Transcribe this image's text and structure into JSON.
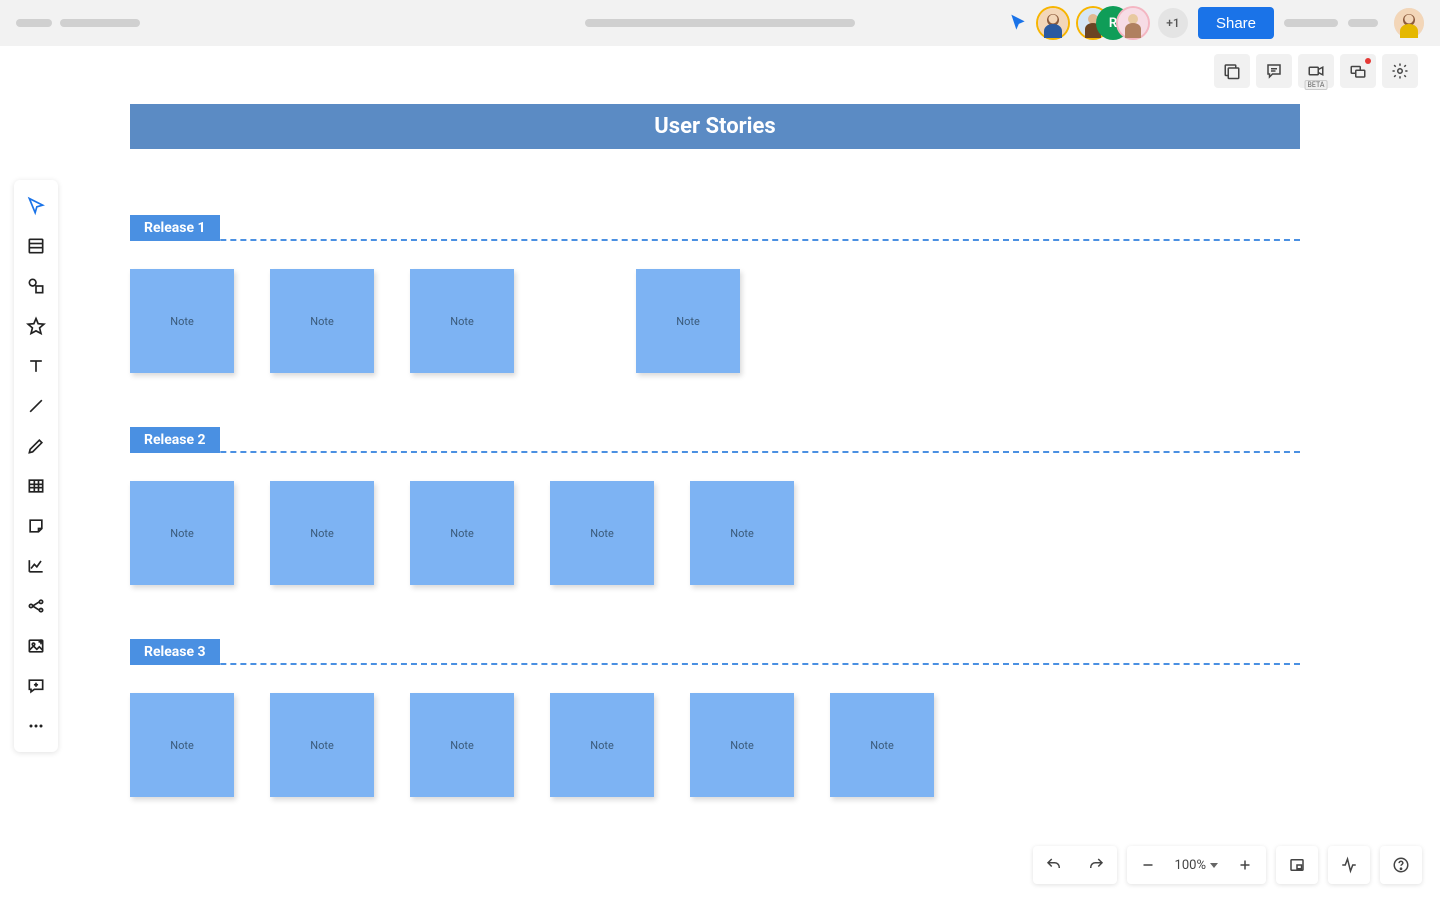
{
  "topbar": {
    "share_label": "Share",
    "plus_more": "+1",
    "avatar_letter": "R"
  },
  "secondbar": {
    "beta_label": "BETA"
  },
  "board": {
    "title": "User Stories",
    "sections": [
      {
        "label": "Release 1",
        "notes": [
          "Note",
          "Note",
          "Note",
          "Note"
        ],
        "irregular": true
      },
      {
        "label": "Release 2",
        "notes": [
          "Note",
          "Note",
          "Note",
          "Note",
          "Note"
        ]
      },
      {
        "label": "Release 3",
        "notes": [
          "Note",
          "Note",
          "Note",
          "Note",
          "Note",
          "Note"
        ]
      }
    ]
  },
  "bottombar": {
    "zoom": "100%"
  }
}
